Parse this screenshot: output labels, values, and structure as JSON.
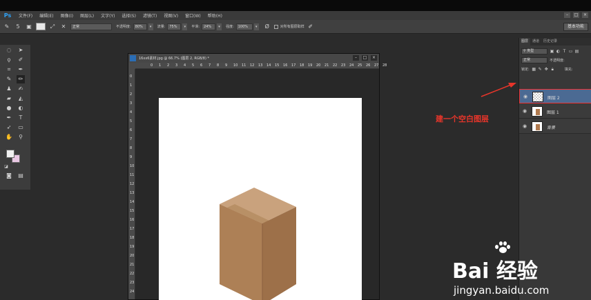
{
  "menubar": {
    "logo": "Ps",
    "items": [
      "文件(F)",
      "编辑(E)",
      "图像(I)",
      "图层(L)",
      "文字(Y)",
      "选择(S)",
      "滤镜(T)",
      "视图(V)",
      "窗口(W)",
      "帮助(H)"
    ]
  },
  "options": {
    "brush_size": "5",
    "mode": "正常",
    "opacity_label": "不透明度:",
    "opacity": "80%",
    "flow_label": "流量:",
    "flow": "75%",
    "smooth_label": "平滑:",
    "smooth": "24%",
    "strength_label": "强度:",
    "strength": "100%",
    "sample_all_label": "对所有图层取样",
    "workspace": "基本功能"
  },
  "document": {
    "title": "16xx6素材.jpg @ 66.7% (图层 2, RGB/8) *",
    "ruler_top": [
      "0",
      "1",
      "2",
      "3",
      "4",
      "5",
      "6",
      "7",
      "8",
      "9",
      "10",
      "11",
      "12",
      "13",
      "14",
      "15",
      "16",
      "17",
      "18",
      "19",
      "20",
      "21",
      "22",
      "23",
      "24",
      "25",
      "26",
      "27",
      "28"
    ],
    "ruler_left": [
      "0",
      "1",
      "2",
      "3",
      "4",
      "5",
      "6",
      "7",
      "8",
      "9",
      "10",
      "11",
      "12",
      "13",
      "14",
      "15",
      "16",
      "17",
      "18",
      "19",
      "20",
      "21",
      "22",
      "23",
      "24"
    ]
  },
  "annotation": {
    "text": "建一个空白图层"
  },
  "layers_panel": {
    "tabs": [
      "图层",
      "通道",
      "历史记录"
    ],
    "filter_kind": "类型",
    "blend_mode": "正常",
    "opacity_label": "不透明度:",
    "lock_label": "锁定:",
    "fill_label": "填充:",
    "layers": [
      {
        "name": "图层 2",
        "thumb": "transparent",
        "selected": true
      },
      {
        "name": "图层 1",
        "thumb": "box",
        "selected": false
      },
      {
        "name": "背景",
        "thumb": "box",
        "selected": false
      }
    ]
  },
  "colors": {
    "accent_blue": "#2fa3f7",
    "selected_layer": "#4b6a93",
    "annotation_red": "#e8352a",
    "box_brown": "#b07a4f",
    "background_swatch": "#e9c7e3"
  },
  "watermark": {
    "brand": "Bai 经验",
    "url": "jingyan.baidu.com"
  }
}
